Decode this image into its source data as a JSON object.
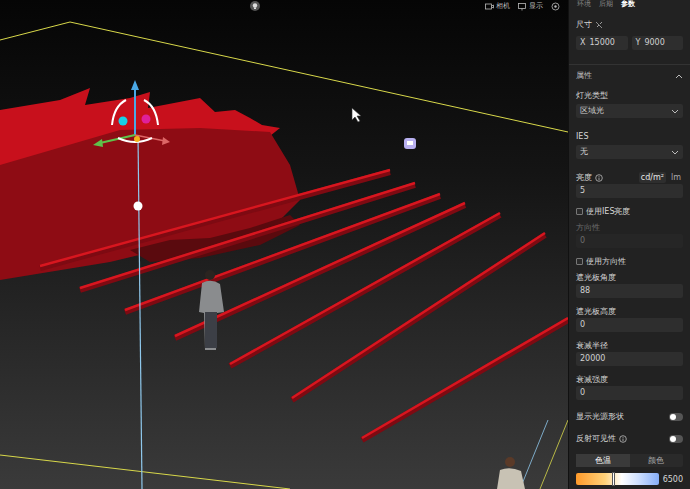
{
  "toolbar": {
    "camera": "相机",
    "display": "显示"
  },
  "panel_tabs": [
    {
      "label": "环境",
      "selected": false
    },
    {
      "label": "后期",
      "selected": false
    },
    {
      "label": "参数",
      "selected": true
    }
  ],
  "size": {
    "title": "尺寸",
    "x_label": "X",
    "x": "15000",
    "y_label": "Y",
    "y": "9000"
  },
  "section": {
    "title": "属性",
    "expanded": true
  },
  "fields": [
    {
      "kind": "select",
      "label": "灯光类型",
      "value": "区域光",
      "disabled": false
    },
    {
      "kind": "select",
      "label": "IES",
      "value": "无",
      "disabled": false
    },
    {
      "kind": "input",
      "label": "亮度",
      "info": true,
      "units": [
        {
          "label": "cd/m²",
          "selected": true
        },
        {
          "label": "lm",
          "selected": false
        }
      ],
      "value": "5",
      "disabled": false
    },
    {
      "kind": "checkbox",
      "label": "使用IES亮度",
      "checked": false
    },
    {
      "kind": "input",
      "label": "方向性",
      "value": "0",
      "disabled": true
    },
    {
      "kind": "checkbox",
      "label": "使用方向性",
      "checked": false
    },
    {
      "kind": "input",
      "label": "遮光板角度",
      "value": "88",
      "disabled": false
    },
    {
      "kind": "input",
      "label": "遮光板高度",
      "value": "0",
      "disabled": false
    },
    {
      "kind": "input",
      "label": "衰减半径",
      "value": "20000",
      "disabled": false
    },
    {
      "kind": "input",
      "label": "衰减强度",
      "value": "0",
      "disabled": false
    },
    {
      "kind": "toggle",
      "label": "显示光源形状",
      "on": false
    },
    {
      "kind": "toggle",
      "label": "反射可见性",
      "info": true,
      "on": false
    }
  ],
  "color_tabs": [
    {
      "label": "色温",
      "selected": true
    },
    {
      "label": "颜色",
      "selected": false
    }
  ],
  "color_temp": {
    "level": 0.45,
    "value": "6500"
  }
}
